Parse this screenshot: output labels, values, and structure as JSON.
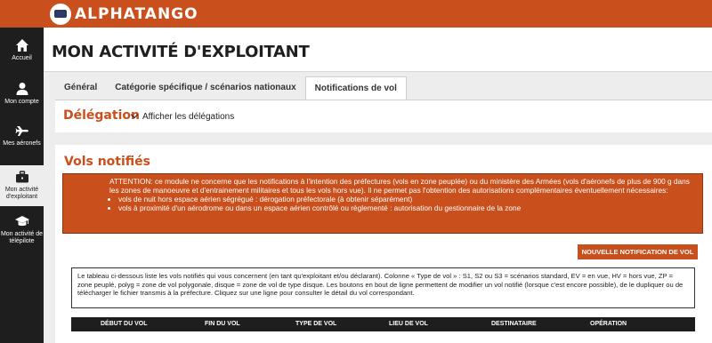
{
  "app": {
    "logo_text": "ALPHATANGO"
  },
  "sidebar": {
    "items": [
      {
        "icon": "home-icon",
        "label": "Accueil"
      },
      {
        "icon": "user-icon",
        "label": "Mon compte"
      },
      {
        "icon": "airplane-icon",
        "label": "Mes aéronefs"
      },
      {
        "icon": "briefcase-icon",
        "label_line1": "Mon activité",
        "label_line2": "d'exploitant"
      },
      {
        "icon": "graduation-cap-icon",
        "label_line1": "Mon activité de",
        "label_line2": "télépilote"
      }
    ]
  },
  "header": {
    "title": "MON ACTIVITÉ D'EXPLOITANT"
  },
  "tabs": [
    {
      "label": "Général"
    },
    {
      "label": "Catégorie spécifique / scénarios nationaux"
    },
    {
      "label": "Notifications de vol"
    }
  ],
  "delegation": {
    "title": "Délégation",
    "toggle_label": "Afficher les délégations"
  },
  "vols": {
    "title": "Vols notifiés",
    "alert": {
      "text": "ATTENTION: ce module ne concerne que les notifications à l'intention des préfectures (vols en zone peuplée) ou du ministère des Armées (vols d'aéronefs de plus de 900 g dans les zones de manoeuvre et d'entrainement militaires et tous les vols hors vue). Il ne permet pas l'obtention des autorisations complémentaires éventuellement nécessaires:",
      "bullets": [
        "vols de nuit hors espace aérien ségrégué : dérogation préfectorale (à obtenir séparément)",
        "vols à proximité d'un aérodrome ou dans un espace aérien contrôlé ou règlementé : autorisation du gestionnaire de la zone"
      ]
    },
    "new_button": "NOUVELLE NOTIFICATION DE VOL",
    "info_text": "Le tableau ci-dessous liste les vols notifiés qui vous concernent (en tant qu'exploitant et/ou déclarant). Colonne « Type de vol » : S1, S2 ou S3 = scénarios standard, EV = en vue, HV = hors vue, ZP = zone peuplé, polyg = zone de vol polygonale, disque = zone de vol de type disque. Les boutons en bout de ligne permettent de modifier un vol notifié (lorsque c'est encore possible), de le dupliquer ou de télécharger le fichier transmis à la préfecture. Cliquez sur une ligne pour consulter le détail du vol correspondant.",
    "columns": [
      "DÉBUT DU VOL",
      "FIN DU VOL",
      "TYPE DE VOL",
      "LIEU DE VOL",
      "DESTINATAIRE",
      "OPÉRATION"
    ]
  }
}
